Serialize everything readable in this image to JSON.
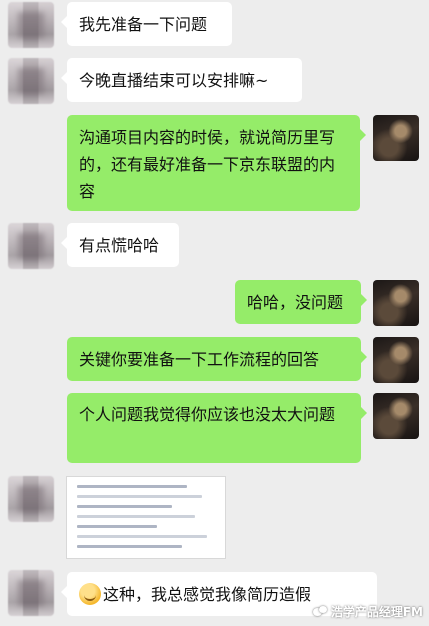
{
  "messages": [
    {
      "side": "left",
      "text": "我先准备一下问题"
    },
    {
      "side": "left",
      "text": "今晚直播结束可以安排嘛~"
    },
    {
      "side": "right",
      "text": "沟通项目内容的时侯，就说简历里写的，还有最好准备一下京东联盟的内容"
    },
    {
      "side": "left",
      "text": "有点慌哈哈"
    },
    {
      "side": "right",
      "text": "哈哈，没问题"
    },
    {
      "side": "right",
      "text": "关键你要准备一下工作流程的回答"
    },
    {
      "side": "right",
      "text": "个人问题我觉得你应该也没太大问题"
    },
    {
      "side": "left",
      "type": "image"
    },
    {
      "side": "left",
      "text": "这种，我总感觉我像简历造假"
    }
  ],
  "watermark": {
    "text": "浩学产品经理FM"
  },
  "colors": {
    "background": "#ededed",
    "incoming": "#ffffff",
    "outgoing": "#95ec69"
  }
}
